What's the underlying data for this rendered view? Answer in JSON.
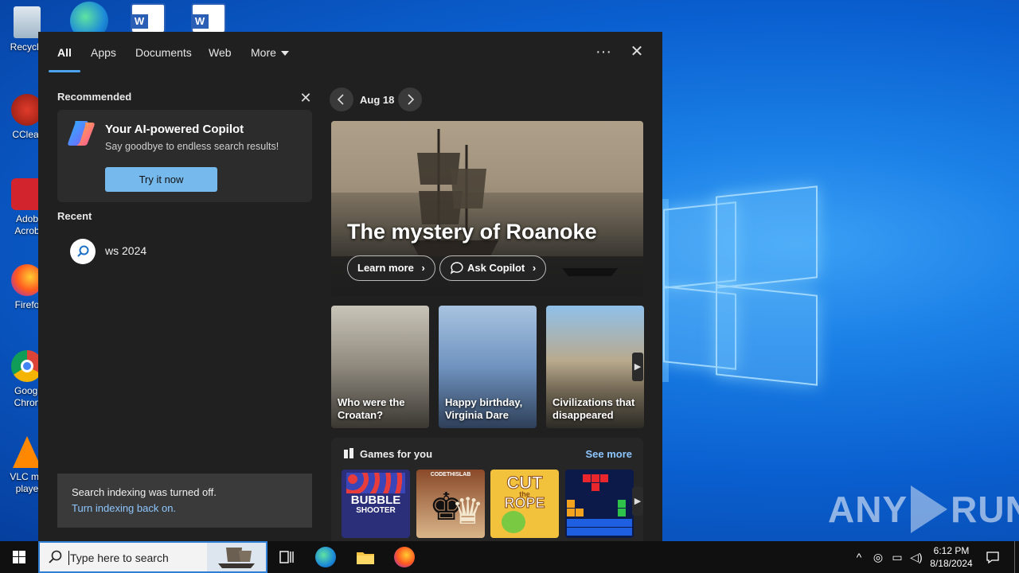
{
  "desktop": {
    "icons": [
      {
        "label": "Recycle"
      },
      {
        "label": "CClear"
      },
      {
        "label": "Adob Acrob"
      },
      {
        "label": "Firefo"
      },
      {
        "label": "Googl Chron"
      },
      {
        "label": "VLC me playe"
      }
    ],
    "watermark": {
      "left": "ANY",
      "right": "RUN"
    }
  },
  "search": {
    "tabs": [
      "All",
      "Apps",
      "Documents",
      "Web",
      "More"
    ],
    "more_icon": "ellipsis-icon",
    "close_icon": "close-icon",
    "recommended_label": "Recommended",
    "copilot": {
      "title": "Your AI-powered Copilot",
      "subtitle": "Say goodbye to endless search results!",
      "button": "Try it now"
    },
    "recent_label": "Recent",
    "recent_items": [
      "ws 2024"
    ],
    "indexing": {
      "message": "Search indexing was turned off.",
      "link": "Turn indexing back on."
    },
    "date": "Aug 18",
    "hero": {
      "title": "The mystery of Roanoke",
      "learn_more": "Learn more",
      "ask_copilot": "Ask Copilot"
    },
    "tiles": [
      "Who were the Croatan?",
      "Happy birthday, Virginia Dare",
      "Civilizations that disappeared"
    ],
    "games": {
      "title": "Games for you",
      "see_more": "See more",
      "items": [
        {
          "line1": "BUBBLE",
          "line2": "SHOOTER"
        },
        {
          "label": "CODETHISLAB"
        },
        {
          "line1": "CUT",
          "line2": "the",
          "line3": "ROPE"
        },
        {
          "label": ""
        }
      ]
    }
  },
  "taskbar": {
    "search_placeholder": "Type here to search",
    "time": "6:12 PM",
    "date": "8/18/2024"
  },
  "colors": {
    "accent": "#4ba3f0",
    "link": "#8dc6ff",
    "try_button": "#76b9ed",
    "panel_bg": "#202020"
  }
}
